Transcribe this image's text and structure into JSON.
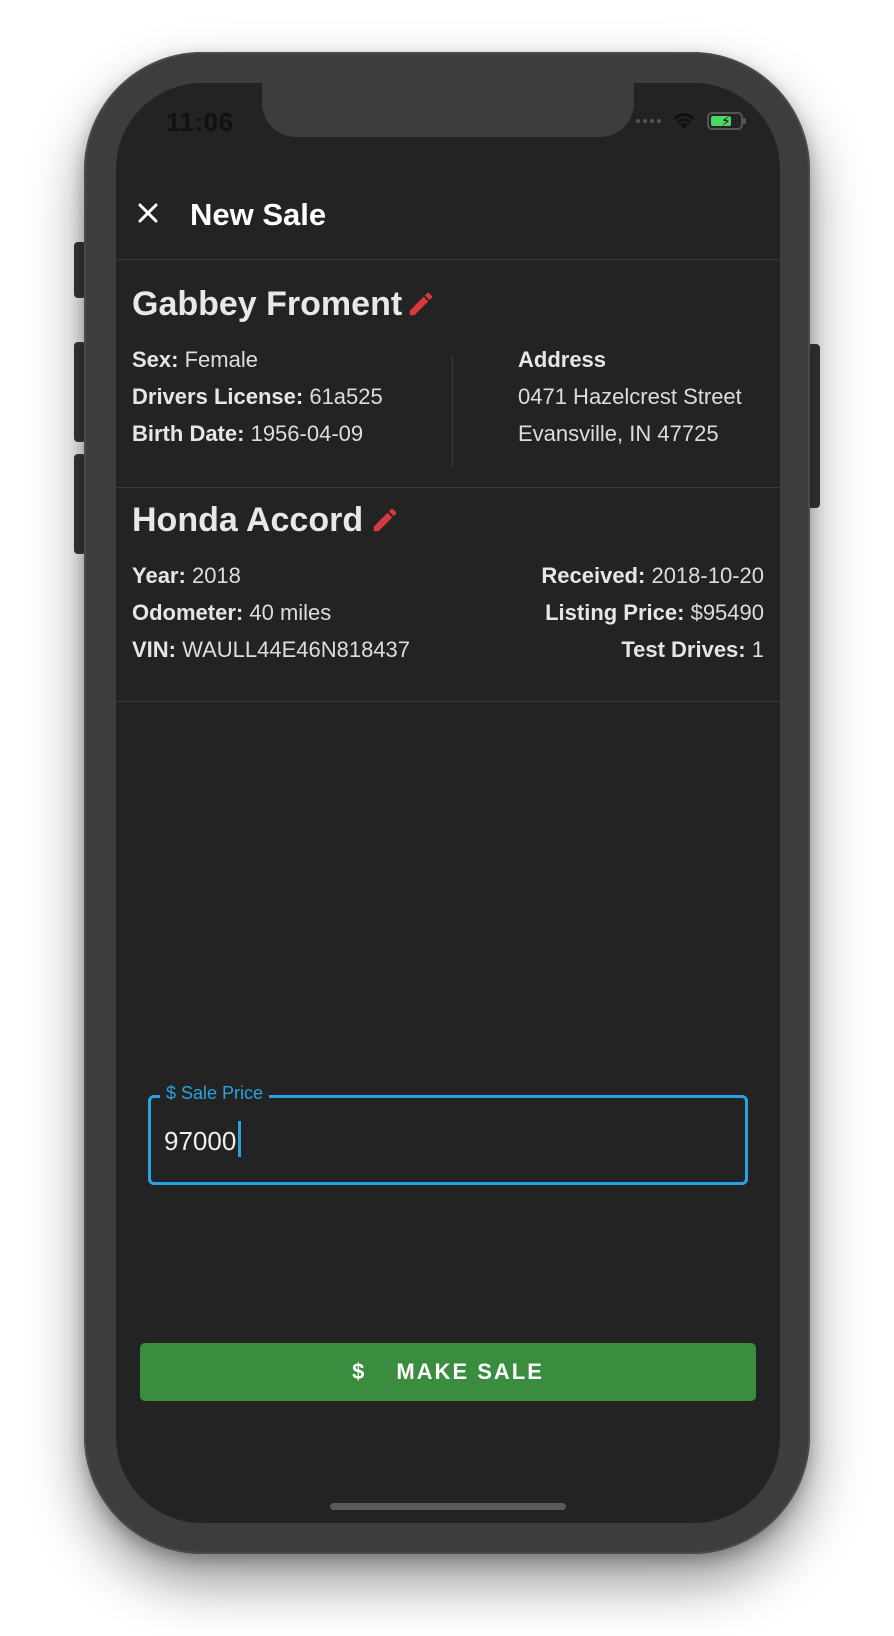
{
  "status_bar": {
    "time": "11:06"
  },
  "app_bar": {
    "title": "New Sale"
  },
  "customer": {
    "name": "Gabbey Froment",
    "sex_label": "Sex:",
    "sex": "Female",
    "license_label": "Drivers License:",
    "license": "61a525",
    "birth_label": "Birth Date:",
    "birth_date": "1956-04-09",
    "address_label": "Address",
    "address_line1": "0471 Hazelcrest Street",
    "address_line2": "Evansville, IN 47725"
  },
  "vehicle": {
    "name": "Honda Accord",
    "year_label": "Year:",
    "year": "2018",
    "odometer_label": "Odometer:",
    "odometer": "40 miles",
    "vin_label": "VIN:",
    "vin": "WAULL44E46N818437",
    "received_label": "Received:",
    "received": "2018-10-20",
    "listing_label": "Listing Price:",
    "listing_price": "$95490",
    "test_drives_label": "Test Drives:",
    "test_drives": "1"
  },
  "sale_price": {
    "label": "$ Sale Price",
    "value": "97000"
  },
  "make_sale": {
    "icon": "$",
    "label": "MAKE SALE"
  },
  "colors": {
    "accent": "#29a3e0",
    "edit": "#d9383e",
    "button": "#3a8c3e",
    "background": "#232323"
  },
  "icons": [
    "close-icon",
    "wifi-icon",
    "battery-icon",
    "edit-icon",
    "dollar-icon"
  ]
}
